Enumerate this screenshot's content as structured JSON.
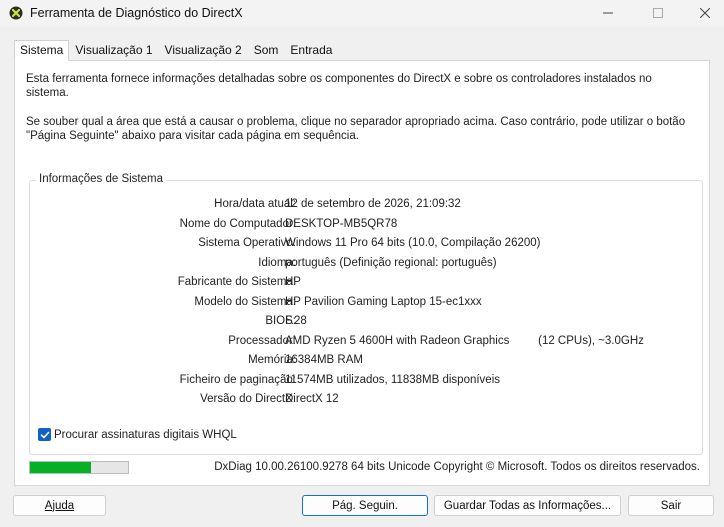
{
  "window": {
    "title": "Ferramenta de Diagnóstico do DirectX",
    "icon": "directx-x-icon",
    "controls": [
      "minimize-icon",
      "maximize-icon",
      "close-icon"
    ]
  },
  "tabs": [
    {
      "label": "Sistema",
      "active": true
    },
    {
      "label": "Visualização 1",
      "active": false
    },
    {
      "label": "Visualização 2",
      "active": false
    },
    {
      "label": "Som",
      "active": false
    },
    {
      "label": "Entrada",
      "active": false
    }
  ],
  "intro": {
    "line1": "Esta ferramenta fornece informações detalhadas sobre os componentes do DirectX e sobre os controladores instalados no sistema.",
    "line2": "Se souber qual a área que está a causar o problema, clique no separador apropriado acima. Caso contrário, pode utilizar o botão \"Página Seguinte\" abaixo para visitar cada página em sequência."
  },
  "system_info": {
    "title": "Informações de Sistema",
    "rows": [
      {
        "label": "Hora/data atual:",
        "value": "12 de setembro de 2026, 21:09:32"
      },
      {
        "label": "Nome do Computador:",
        "value": "DESKTOP-MB5QR78"
      },
      {
        "label": "Sistema Operativo:",
        "value": "Windows 11 Pro 64 bits (10.0, Compilação 26200)"
      },
      {
        "label": "Idioma:",
        "value": "português (Definição regional: português)"
      },
      {
        "label": "Fabricante do Sistema:",
        "value": "HP"
      },
      {
        "label": "Modelo do Sistema:",
        "value": "HP Pavilion Gaming Laptop 15-ec1xxx"
      },
      {
        "label": "BIOS:",
        "value": "F.28"
      },
      {
        "label": "Processador:",
        "value": "AMD Ryzen 5 4600H with Radeon Graphics         (12 CPUs), ~3.0GHz"
      },
      {
        "label": "Memória:",
        "value": "16384MB RAM"
      },
      {
        "label": "Ficheiro de paginação:",
        "value": "11574MB utilizados, 11838MB disponíveis"
      },
      {
        "label": "Versão do DirectX:",
        "value": "DirectX 12"
      }
    ],
    "checkbox_label": "Procurar assinaturas digitais WHQL",
    "checkbox_checked": true
  },
  "progress": {
    "fraction": 0.62,
    "color": "#06b025"
  },
  "copyright": "DxDiag 10.00.26100.9278 64 bits Unicode Copyright © Microsoft. Todos os direitos reservados.",
  "buttons": {
    "help_label": "Ajuda",
    "next_label": "Pág. Seguin.",
    "save_label": "Guardar Todas as Informações...",
    "exit_label": "Sair"
  },
  "colors": {
    "accent": "#1060c8",
    "default_button_border": "#1a6fc9"
  }
}
